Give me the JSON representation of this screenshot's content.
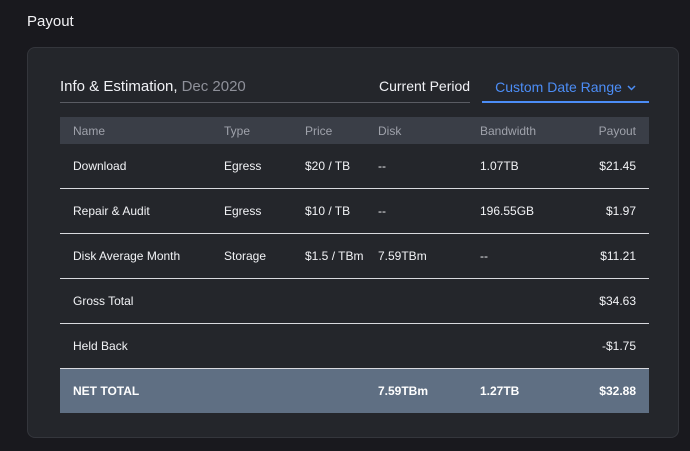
{
  "page": {
    "section_title": "Payout"
  },
  "header": {
    "title": "Info & Estimation,",
    "period": "Dec 2020",
    "tabs": [
      {
        "label": "Current Period",
        "active": false
      },
      {
        "label": "Custom Date Range",
        "active": true
      }
    ],
    "accent_color": "#4c8df6"
  },
  "table": {
    "columns": [
      "Name",
      "Type",
      "Price",
      "Disk",
      "Bandwidth",
      "Payout"
    ],
    "rows": [
      {
        "name": "Download",
        "type": "Egress",
        "price": "$20 / TB",
        "disk": "--",
        "bandwidth": "1.07TB",
        "payout": "$21.45"
      },
      {
        "name": "Repair & Audit",
        "type": "Egress",
        "price": "$10 / TB",
        "disk": "--",
        "bandwidth": "196.55GB",
        "payout": "$1.97"
      },
      {
        "name": "Disk Average Month",
        "type": "Storage",
        "price": "$1.5 / TBm",
        "disk": "7.59TBm",
        "bandwidth": "--",
        "payout": "$11.21"
      },
      {
        "name": "Gross Total",
        "type": "",
        "price": "",
        "disk": "",
        "bandwidth": "",
        "payout": "$34.63"
      },
      {
        "name": "Held Back",
        "type": "",
        "price": "",
        "disk": "",
        "bandwidth": "",
        "payout": "-$1.75"
      }
    ],
    "total": {
      "name": "NET TOTAL",
      "disk": "7.59TBm",
      "bandwidth": "1.27TB",
      "payout": "$32.88"
    }
  }
}
